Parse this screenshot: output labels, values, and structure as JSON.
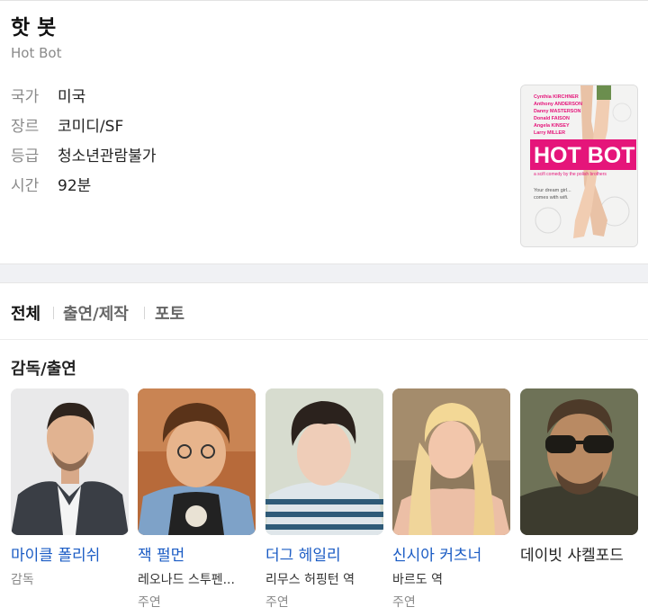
{
  "movie": {
    "title": "핫 봇",
    "original_title": "Hot Bot",
    "info": [
      {
        "label": "국가",
        "value": "미국"
      },
      {
        "label": "장르",
        "value": "코미디/SF"
      },
      {
        "label": "등급",
        "value": "청소년관람불가"
      },
      {
        "label": "시간",
        "value": "92분"
      }
    ],
    "poster": {
      "credits": [
        "Cynthia KIRCHNER",
        "Anthony ANDERSON",
        "Danny MASTERSON",
        "Donald FAISON",
        "Angela KINSEY",
        "Larry MILLER"
      ],
      "title": "HOT BOT",
      "tagline": "a scifi comedy by the polish brothers",
      "slogan_1": "Your dream girl...",
      "slogan_2": "comes with wifi."
    }
  },
  "tabs": [
    {
      "label": "전체",
      "active": true
    },
    {
      "label": "출연/제작",
      "active": false
    },
    {
      "label": "포토",
      "active": false
    }
  ],
  "cast_section": {
    "title": "감독/출연",
    "people": [
      {
        "name": "마이클 폴리쉬",
        "role": "감독",
        "part": "",
        "linked": true
      },
      {
        "name": "잭 펄먼",
        "role": "레오나드 스투펜...",
        "part": "주연",
        "linked": true
      },
      {
        "name": "더그 헤일리",
        "role": "리무스 허핑턴 역",
        "part": "주연",
        "linked": true
      },
      {
        "name": "신시아 커츠너",
        "role": "바르도 역",
        "part": "주연",
        "linked": true
      },
      {
        "name": "데이빗 샤켈포드",
        "role": "",
        "part": "",
        "linked": false
      }
    ]
  },
  "colors": {
    "link": "#1a5bc4",
    "poster_accent": "#e5157a"
  }
}
